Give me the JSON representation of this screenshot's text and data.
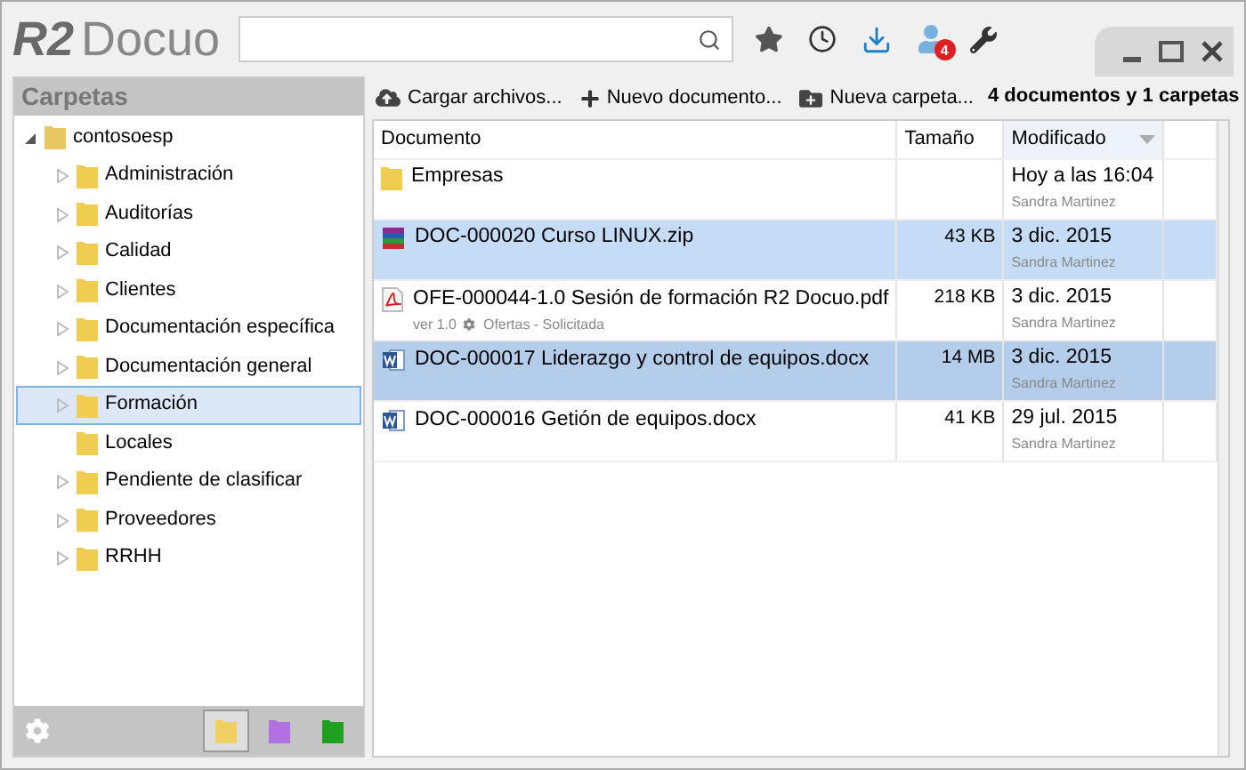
{
  "app": {
    "logo_mark": "R2",
    "logo_name": "Docuo",
    "notifications": "4"
  },
  "sidebar": {
    "title": "Carpetas",
    "tree": [
      {
        "label": "contosoesp",
        "expanded": true,
        "selected": false,
        "children": [
          {
            "label": "Administración",
            "expandable": true,
            "selected": false
          },
          {
            "label": "Auditorías",
            "expandable": true,
            "selected": false
          },
          {
            "label": "Calidad",
            "expandable": true,
            "selected": false
          },
          {
            "label": "Clientes",
            "expandable": true,
            "selected": false
          },
          {
            "label": "Documentación específica",
            "expandable": true,
            "selected": false
          },
          {
            "label": "Documentación general",
            "expandable": true,
            "selected": false
          },
          {
            "label": "Formación",
            "expandable": true,
            "selected": true
          },
          {
            "label": "Locales",
            "expandable": false,
            "selected": false
          },
          {
            "label": "Pendiente de clasificar",
            "expandable": true,
            "selected": false
          },
          {
            "label": "Proveedores",
            "expandable": true,
            "selected": false
          },
          {
            "label": "RRHH",
            "expandable": true,
            "selected": false
          }
        ]
      }
    ],
    "views": [
      {
        "color": "#f0d060",
        "selected": true
      },
      {
        "color": "#b070e0",
        "selected": false
      },
      {
        "color": "#20a020",
        "selected": false
      }
    ]
  },
  "toolbar": {
    "actions": [
      {
        "label": "Cargar archivos...",
        "kind": "upload"
      },
      {
        "label": "Nuevo documento...",
        "kind": "new"
      },
      {
        "label": "Nueva carpeta...",
        "kind": "folder"
      }
    ],
    "summary": "4 documentos y 1 carpetas"
  },
  "table": {
    "columns": [
      {
        "label": "Documento",
        "sorted": false
      },
      {
        "label": "Tamaño",
        "sorted": false
      },
      {
        "label": "Modificado",
        "sorted": true
      }
    ],
    "rows": [
      {
        "kind": "folder",
        "name": "Empresas",
        "size": "",
        "date": "Hoy a las 16:04",
        "author": "Sandra Martinez",
        "selected": false
      },
      {
        "kind": "zip",
        "name": "DOC-000020 Curso LINUX.zip",
        "size": "43 KB",
        "date": "3 dic. 2015",
        "author": "Sandra Martinez",
        "selected": true
      },
      {
        "kind": "pdf",
        "name": "OFE-000044-1.0 Sesión de formación R2 Docuo.pdf",
        "size": "218 KB",
        "date": "3 dic. 2015",
        "author": "Sandra Martinez",
        "selected": false,
        "version": "ver 1.0",
        "workflow": "Ofertas - Solicitada"
      },
      {
        "kind": "docx",
        "name": "DOC-000017 Liderazgo y control de equipos.docx",
        "size": "14 MB",
        "date": "3 dic. 2015",
        "author": "Sandra Martinez",
        "selected": true
      },
      {
        "kind": "docx",
        "name": "DOC-000016 Getión de equipos.docx",
        "size": "41 KB",
        "date": "29 jul. 2015",
        "author": "Sandra Martinez",
        "selected": false
      }
    ]
  }
}
